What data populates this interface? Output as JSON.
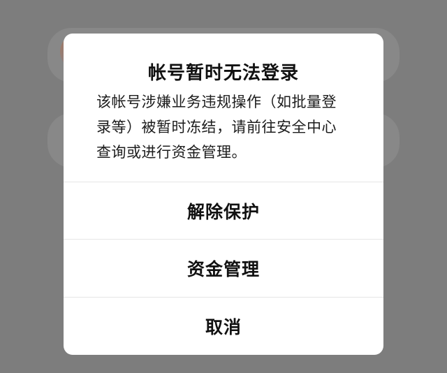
{
  "dialog": {
    "title": "帐号暂时无法登录",
    "message": "该帐号涉嫌业务违规操作（如批量登录等）被暂时冻结，请前往安全中心查询或进行资金管理。",
    "actions": [
      {
        "label": "解除保护"
      },
      {
        "label": "资金管理"
      },
      {
        "label": "取消"
      }
    ]
  },
  "colors": {
    "overlay": "#7d7d7d",
    "dialog_bg": "#ffffff",
    "text": "#111111",
    "divider": "#e6e6e6"
  }
}
